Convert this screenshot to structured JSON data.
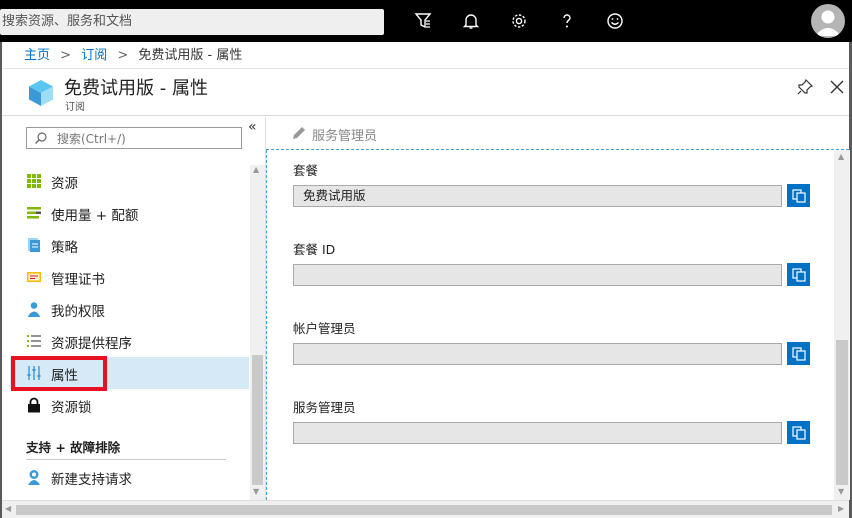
{
  "topbar": {
    "search_placeholder": "搜索资源、服务和文档"
  },
  "breadcrumb": {
    "home": "主页",
    "subscriptions": "订阅",
    "current": "免费试用版 - 属性"
  },
  "blade": {
    "title": "免费试用版 - 属性",
    "subtitle": "订阅"
  },
  "menu": {
    "search_placeholder": "搜索(Ctrl+/)",
    "items": [
      {
        "label": "资源",
        "icon": "grid-icon"
      },
      {
        "label": "使用量 + 配额",
        "icon": "usage-icon"
      },
      {
        "label": "策略",
        "icon": "policy-icon"
      },
      {
        "label": "管理证书",
        "icon": "certificate-icon"
      },
      {
        "label": "我的权限",
        "icon": "user-icon"
      },
      {
        "label": "资源提供程序",
        "icon": "list-icon"
      },
      {
        "label": "属性",
        "icon": "properties-icon"
      },
      {
        "label": "资源锁",
        "icon": "lock-icon"
      }
    ],
    "section_title": "支持 + 故障排除",
    "support_items": [
      {
        "label": "新建支持请求",
        "icon": "support-icon"
      }
    ]
  },
  "toolbar": {
    "service_admin_label": "服务管理员"
  },
  "fields": [
    {
      "label": "套餐",
      "value": "免费试用版"
    },
    {
      "label": "套餐 ID",
      "value": ""
    },
    {
      "label": "帐户管理员",
      "value": ""
    },
    {
      "label": "服务管理员",
      "value": ""
    }
  ],
  "colors": {
    "accent": "#0072c6",
    "active_bg": "#d5e9f7",
    "highlight": "#e81123"
  }
}
